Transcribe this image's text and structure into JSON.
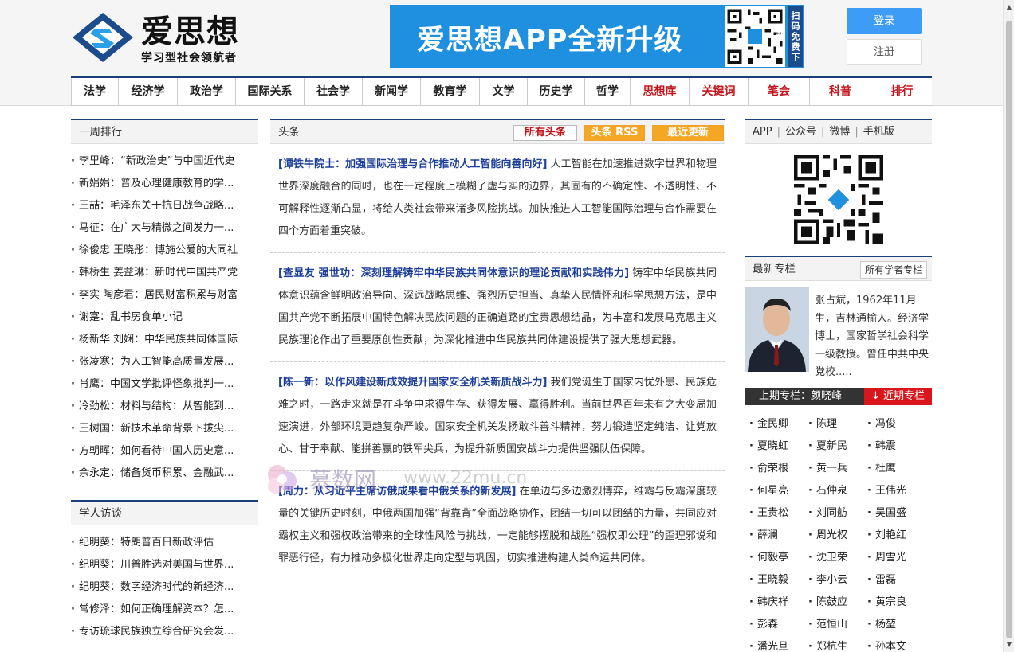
{
  "header": {
    "logo_title": "爱思想",
    "logo_sub": "学习型社会领航者",
    "banner_text": "爱思想APP全新升级",
    "banner_side": "扫码免费下载",
    "login": "登录",
    "register": "注册",
    "brand_blue": "#1f8fe0",
    "nav_dark": "#1b3f78"
  },
  "nav": [
    {
      "label": "法学",
      "red": false
    },
    {
      "label": "经济学",
      "red": false
    },
    {
      "label": "政治学",
      "red": false
    },
    {
      "label": "国际关系",
      "red": false
    },
    {
      "label": "社会学",
      "red": false
    },
    {
      "label": "新闻学",
      "red": false
    },
    {
      "label": "教育学",
      "red": false
    },
    {
      "label": "文学",
      "red": false
    },
    {
      "label": "历史学",
      "red": false
    },
    {
      "label": "哲学",
      "red": false
    },
    {
      "label": "思想库",
      "red": true
    },
    {
      "label": "关键词",
      "red": true
    },
    {
      "label": "笔会",
      "red": true
    },
    {
      "label": "科普",
      "red": true
    },
    {
      "label": "排行",
      "red": true
    }
  ],
  "weekly": {
    "title": "一周排行",
    "items": [
      "李里峰：“新政治史”与中国近代史",
      "新娟娟：普及心理健康教育的学...",
      "王喆：毛泽东关于抗日战争战略...",
      "马征：在广大与精微之间发力一...",
      "徐俊忠 王晓彤：博施公爱的大同社",
      "韩桥生 姜益琳：新时代中国共产党",
      "李实 陶彦君：居民财富积累与财富",
      "谢寔：乱书房食单小记",
      "杨新华 刘娴：中华民族共同体国际",
      "张凌寒：为人工智能高质量发展...",
      "肖鹰：中国文学批评怪象批判一...",
      "冷劲松：材料与结构：从智能到...",
      "王树国：新技术革命背景下拔尖...",
      "方朝晖：如何看待中国人历史意...",
      "余永定：储备货币积累、金融武..."
    ]
  },
  "interviews": {
    "title": "学人访谈",
    "items": [
      "纪明葵：特朗普百日新政评估",
      "纪明葵：川普胜选对美国与世界...",
      "纪明葵：数字经济时代的新经济...",
      "常修泽：如何正确理解资本？怎...",
      "专访琉球民族独立综合研究会发..."
    ]
  },
  "headlines": {
    "title": "头条",
    "tab_all": "所有头条",
    "tab_head": "头条 RSS",
    "tab_new": "最近更新",
    "articles": [
      {
        "title": "[谭铁牛院士：加强国际治理与合作推动人工智能向善向好]",
        "body": " 人工智能在加速推进数字世界和物理世界深度融合的同时，也在一定程度上模糊了虚与实的边界，其固有的不确定性、不透明性、不可解释性逐渐凸显，将给人类社会带来诸多风险挑战。加快推进人工智能国际治理与合作需要在四个方面着重突破。"
      },
      {
        "title": "[查显友 强世功：深刻理解铸牢中华民族共同体意识的理论贡献和实践伟力]",
        "body": " 铸牢中华民族共同体意识蕴含鲜明政治导向、深远战略思维、强烈历史担当、真挚人民情怀和科学思想方法，是中国共产党不断拓展中国特色解决民族问题的正确道路的宝贵思想结晶，为丰富和发展马克思主义民族理论作出了重要原创性贡献，为深化推进中华民族共同体建设提供了强大思想武器。"
      },
      {
        "title": "[陈一新：以作风建设新成效提升国家安全机关新质战斗力]",
        "body": " 我们党诞生于国家内忧外患、民族危难之时，一路走来就是在斗争中求得生存、获得发展、赢得胜利。当前世界百年未有之大变局加速演进，外部环境更趋复杂严峻。国家安全机关发扬敢斗善斗精神，努力锻造坚定纯洁、让党放心、甘于奉献、能拼善赢的铁军尖兵，为提升新质国安战斗力提供坚强队伍保障。"
      },
      {
        "title": "[周力：从习近平主席访俄成果看中俄关系的新发展]",
        "body": " 在单边与多边激烈博弈，维霸与反霸深度较量的关键历史时刻，中俄两国加强“背靠背”全面战略协作，团结一切可以团结的力量，共同应对霸权主义和强权政治带来的全球性风险与挑战，一定能够摆脱和战胜“强权即公理”的歪理邪说和罪恶行径，有力推动多极化世界走向定型与巩固，切实推进构建人类命运共同体。"
      }
    ]
  },
  "right": {
    "app_links": [
      "APP",
      "公众号",
      "微博",
      "手机版"
    ],
    "latest_title": "最新专栏",
    "latest_all": "所有学者专栏",
    "person_text": "张占斌，1962年11月生，吉林通榆人。经济学博士，国家哲学社会科学一级教授。曾任中共中央党校.....",
    "prev_label": "上期专栏：颜晓峰",
    "next_label": "↓ 近期专栏",
    "scholars": [
      "金民卿",
      "陈理",
      "冯俊",
      "夏晓虹",
      "夏新民",
      "韩震",
      "俞荣根",
      "黄一兵",
      "杜鹰",
      "何星亮",
      "石仲泉",
      "王伟光",
      "王贵松",
      "刘同舫",
      "吴国盛",
      "薛澜",
      "周光权",
      "刘艳红",
      "何毅亭",
      "沈卫荣",
      "周雪光",
      "王晓毅",
      "李小云",
      "雷磊",
      "韩庆祥",
      "陈鼓应",
      "黄宗良",
      "彭森",
      "范恒山",
      "杨堃",
      "潘光旦",
      "郑杭生",
      "孙本文"
    ]
  },
  "watermark": {
    "text": "慕数网",
    "url": "www.22mu.cn"
  }
}
